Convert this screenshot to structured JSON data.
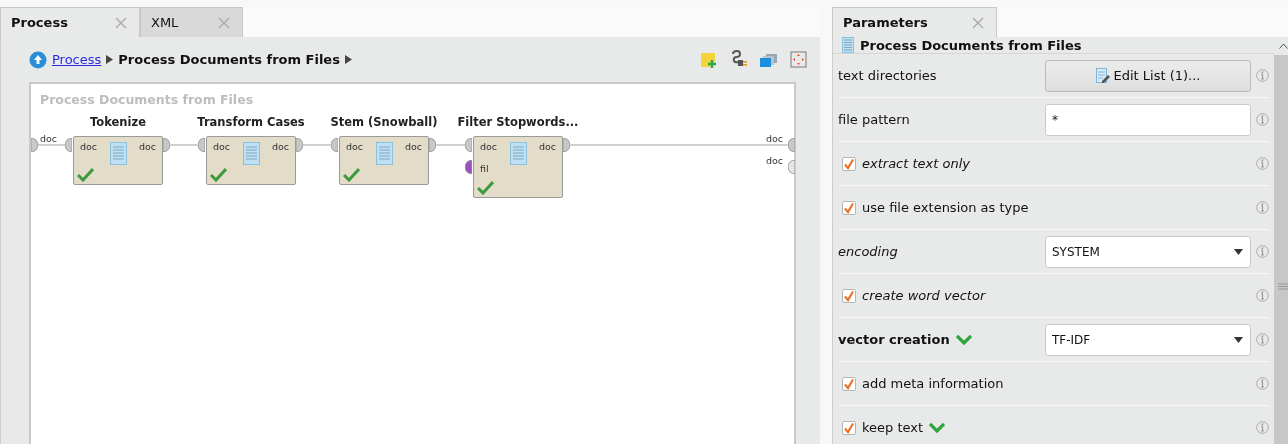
{
  "process_tabs": [
    {
      "label": "Process",
      "selected": true
    },
    {
      "label": "XML",
      "selected": false
    }
  ],
  "breadcrumb": {
    "link": "Process",
    "current": "Process Documents from Files"
  },
  "canvas": {
    "title": "Process Documents from Files",
    "input_ports": [
      {
        "label": "doc"
      }
    ],
    "output_ports": [
      {
        "label": "doc",
        "connected": true
      },
      {
        "label": "doc",
        "connected": false
      }
    ],
    "operators": [
      {
        "name": "Tokenize",
        "inputs": [
          {
            "label": "doc",
            "color": "#c8c8c8"
          }
        ],
        "outputs": [
          {
            "label": "doc"
          }
        ],
        "ready": true
      },
      {
        "name": "Transform Cases",
        "inputs": [
          {
            "label": "doc",
            "color": "#c8c8c8"
          }
        ],
        "outputs": [
          {
            "label": "doc"
          }
        ],
        "ready": true
      },
      {
        "name": "Stem (Snowball)",
        "inputs": [
          {
            "label": "doc",
            "color": "#c8c8c8"
          }
        ],
        "outputs": [
          {
            "label": "doc"
          }
        ],
        "ready": true
      },
      {
        "name": "Filter Stopwords...",
        "inputs": [
          {
            "label": "doc",
            "color": "#c8c8c8"
          },
          {
            "label": "fil",
            "color": "#9b4fc0"
          }
        ],
        "outputs": [
          {
            "label": "doc"
          }
        ],
        "ready": true
      }
    ]
  },
  "parameters_tab": {
    "label": "Parameters",
    "selected": true
  },
  "parameters": {
    "operator": "Process Documents from Files",
    "rows": [
      {
        "kind": "button",
        "label": "text directories",
        "expert": false,
        "primary": false,
        "value": "Edit List (1)...",
        "modified": false
      },
      {
        "kind": "text",
        "label": "file pattern",
        "expert": false,
        "primary": false,
        "value": "*",
        "modified": false
      },
      {
        "kind": "checkbox",
        "label": "extract text only",
        "expert": true,
        "primary": false,
        "checked": true,
        "modified": false
      },
      {
        "kind": "checkbox",
        "label": "use file extension as type",
        "expert": false,
        "primary": false,
        "checked": true,
        "modified": false
      },
      {
        "kind": "select",
        "label": "encoding",
        "expert": true,
        "primary": false,
        "value": "SYSTEM",
        "modified": false
      },
      {
        "kind": "checkbox",
        "label": "create word vector",
        "expert": true,
        "primary": false,
        "checked": true,
        "modified": false
      },
      {
        "kind": "select",
        "label": "vector creation",
        "expert": false,
        "primary": true,
        "value": "TF-IDF",
        "modified": true
      },
      {
        "kind": "checkbox",
        "label": "add meta information",
        "expert": false,
        "primary": false,
        "checked": true,
        "modified": false
      },
      {
        "kind": "checkbox",
        "label": "keep text",
        "expert": false,
        "primary": false,
        "checked": true,
        "modified": true
      }
    ]
  }
}
